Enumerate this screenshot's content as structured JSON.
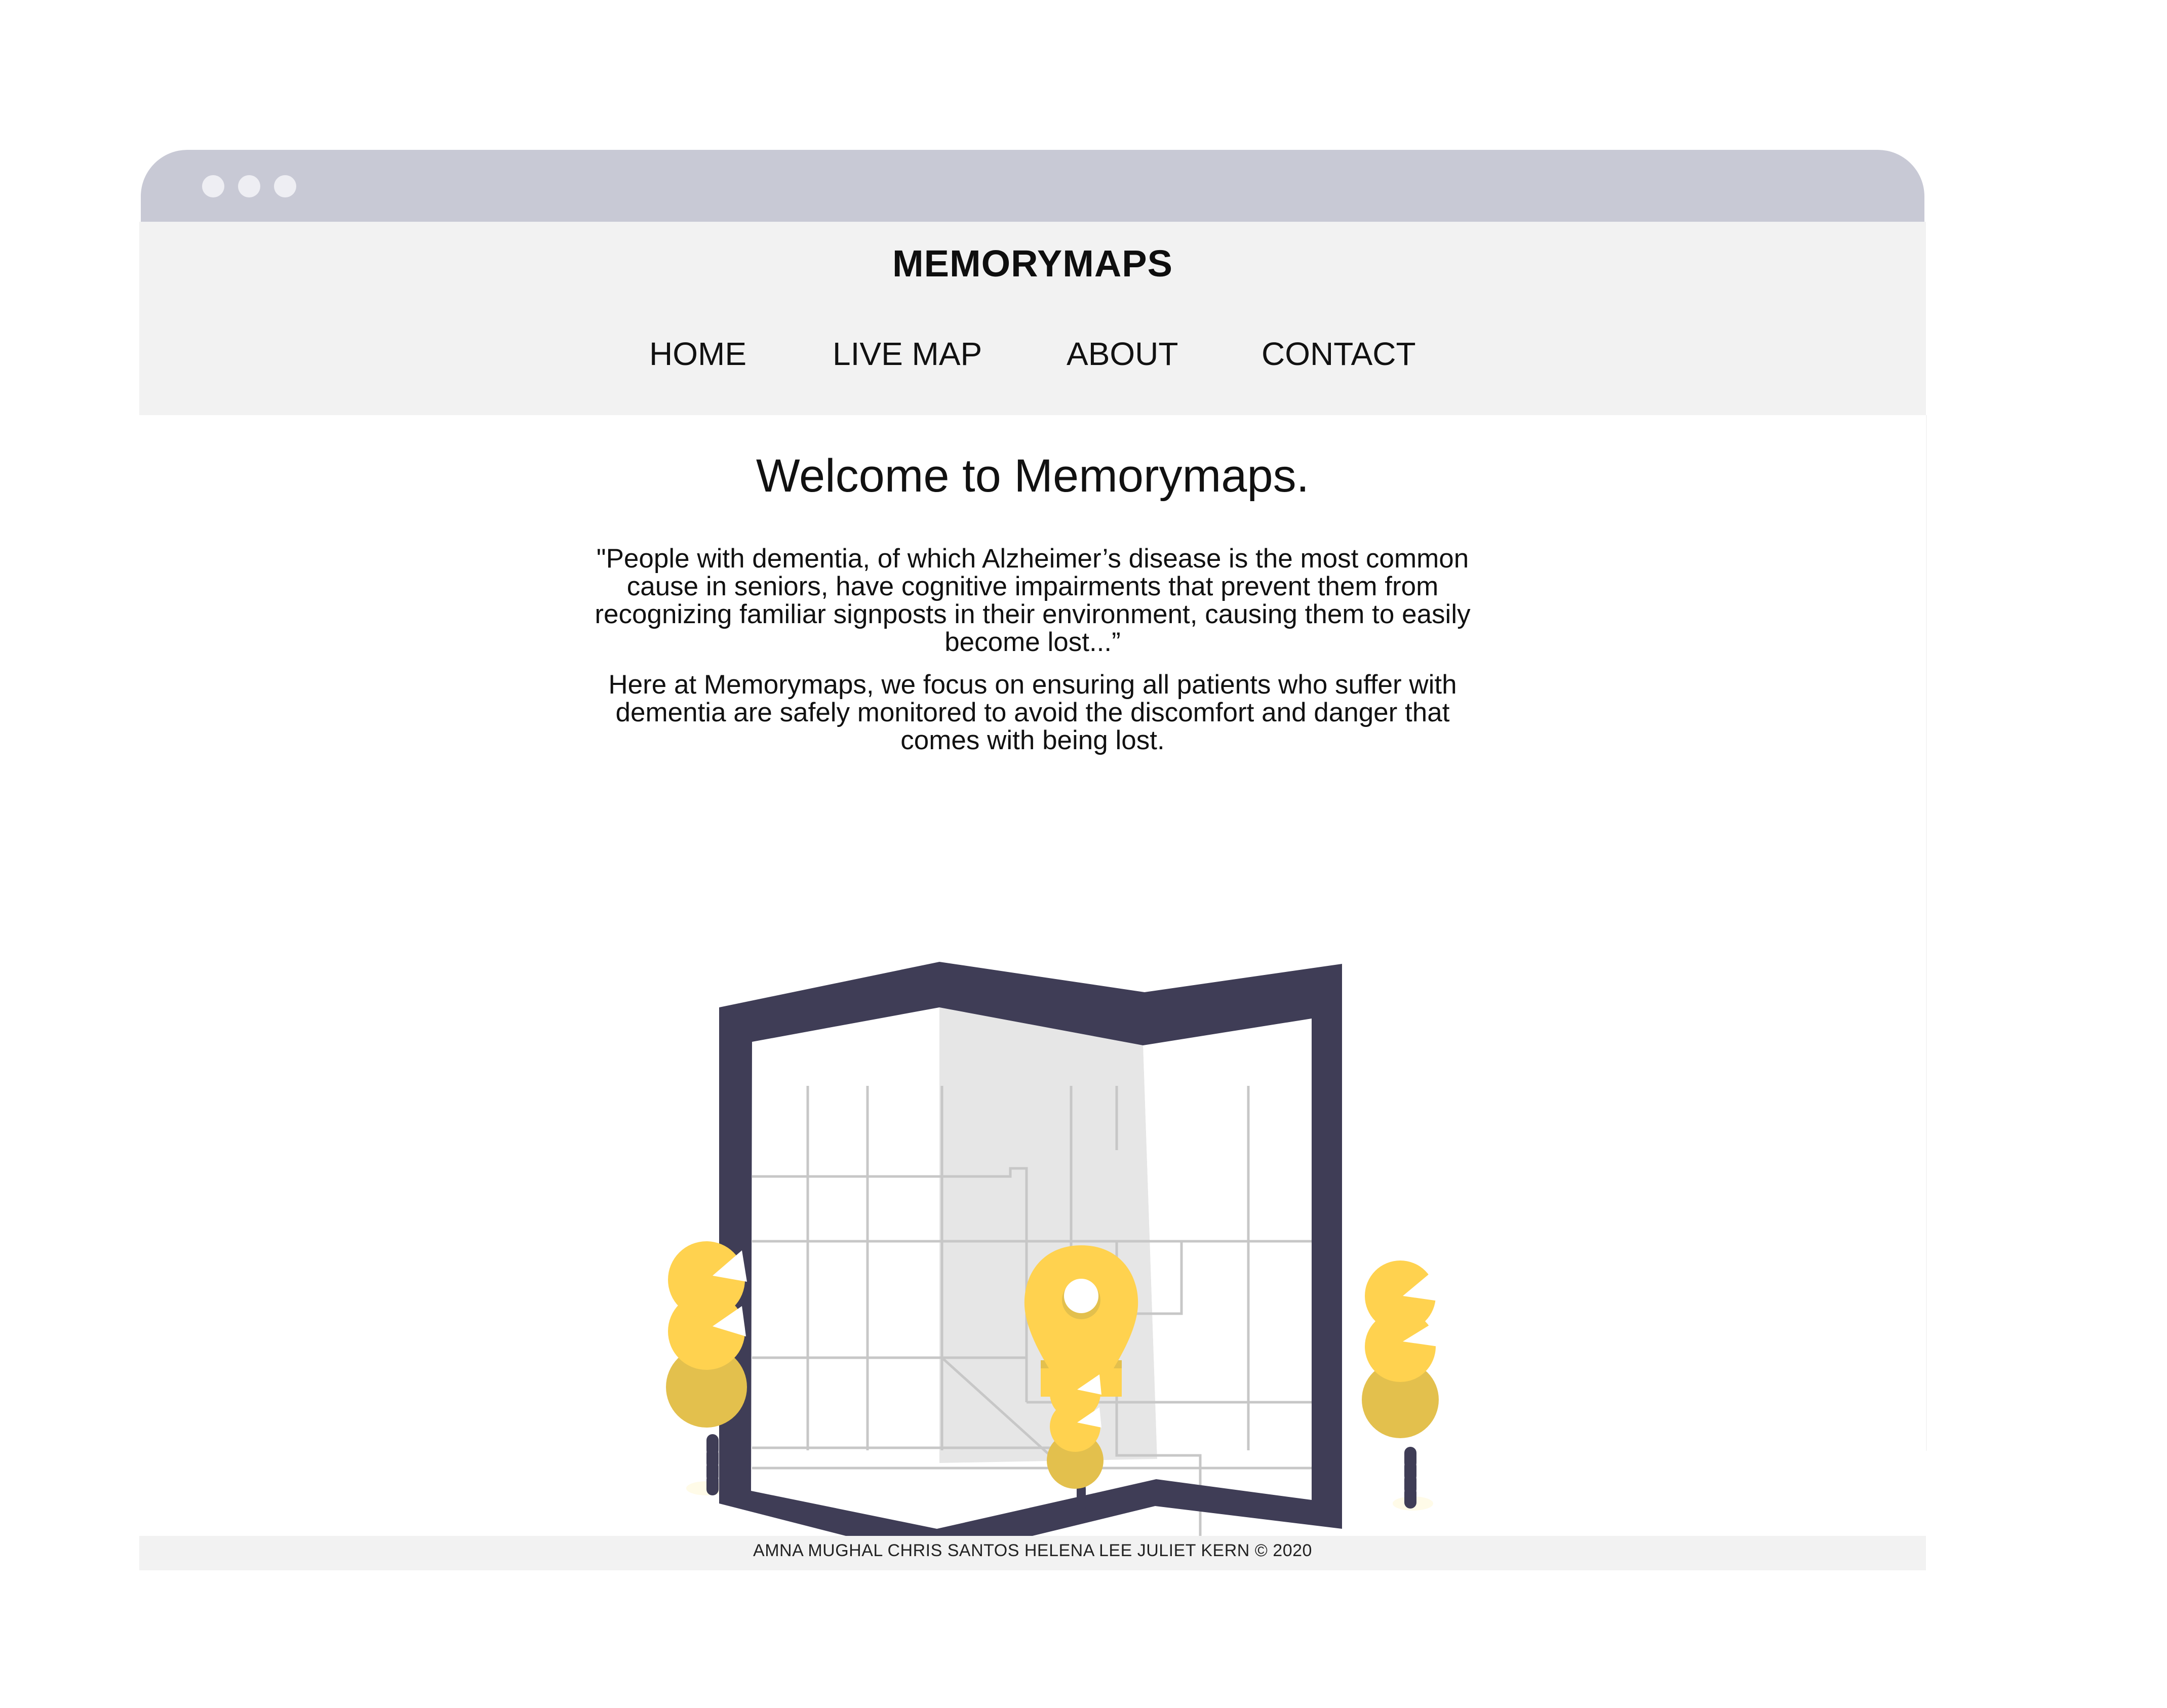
{
  "window": {
    "controls": [
      "dot",
      "dot",
      "dot"
    ]
  },
  "header": {
    "brand": "MEMORYMAPS",
    "nav": {
      "home": "HOME",
      "live_map": "LIVE MAP",
      "about": "ABOUT",
      "contact": "CONTACT"
    }
  },
  "main": {
    "title": "Welcome to Memorymaps.",
    "quote": "\"People with dementia, of which Alzheimer’s disease is the most common cause in seniors, have cognitive impairments that prevent them from recognizing familiar signposts in their environment, causing them to easily become lost...”",
    "description": "Here at Memorymaps, we focus on ensuring all patients who suffer with dementia are safely monitored to avoid the discomfort and danger that comes with being lost.",
    "illustration": "map-with-location-pin-and-trees"
  },
  "footer": {
    "credits": "AMNA MUGHAL CHRIS SANTOS HELENA LEE JULIET KERN © 2020"
  },
  "colors": {
    "titlebar": "#c8c9d5",
    "header_bg": "#f2f2f2",
    "map_frame": "#3f3d56",
    "accent_yellow": "#ffd24f",
    "tree_shade": "#e3c04d"
  }
}
